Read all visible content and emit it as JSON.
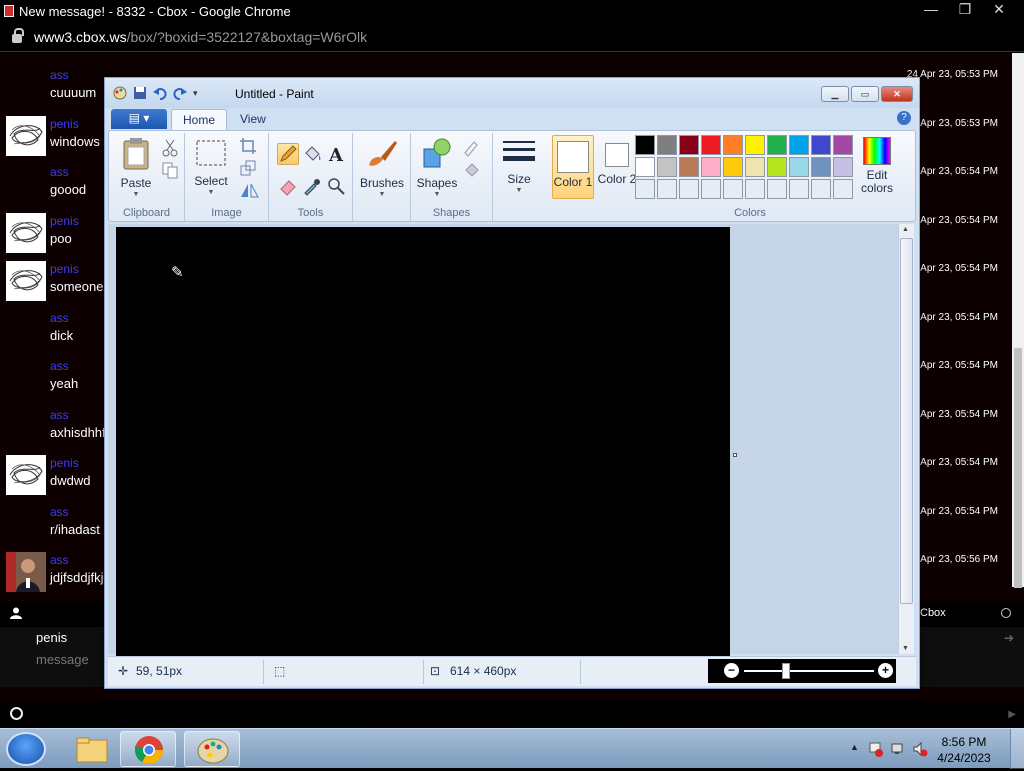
{
  "browser": {
    "tab_title": "New message! - 8332 - Cbox - Google Chrome",
    "url_host": "www3.cbox.ws",
    "url_path": "/box/?boxid=3522127&boxtag=W6rOlk"
  },
  "chat": {
    "messages": [
      {
        "name": "ass",
        "text": "cuuuum",
        "time": "24 Apr 23, 05:53 PM",
        "avatar": "none"
      },
      {
        "name": "penis",
        "text": "windows",
        "time": "4 Apr 23, 05:53 PM",
        "avatar": "scribble"
      },
      {
        "name": "ass",
        "text": "goood",
        "time": "4 Apr 23, 05:54 PM",
        "avatar": "none"
      },
      {
        "name": "penis",
        "text": "poo",
        "time": "4 Apr 23, 05:54 PM",
        "avatar": "scribble"
      },
      {
        "name": "penis",
        "text": "someone",
        "time": "4 Apr 23, 05:54 PM",
        "avatar": "scribble"
      },
      {
        "name": "ass",
        "text": "dick",
        "time": "4 Apr 23, 05:54 PM",
        "avatar": "none"
      },
      {
        "name": "ass",
        "text": "yeah",
        "time": "4 Apr 23, 05:54 PM",
        "avatar": "none"
      },
      {
        "name": "ass",
        "text": "axhisdhhf",
        "time": "4 Apr 23, 05:54 PM",
        "avatar": "none"
      },
      {
        "name": "penis",
        "text": "dwdwd",
        "time": "4 Apr 23, 05:54 PM",
        "avatar": "scribble"
      },
      {
        "name": "ass",
        "text": "r/ihadast",
        "time": "4 Apr 23, 05:54 PM",
        "avatar": "none"
      },
      {
        "name": "ass",
        "text": "jdjfsddjfkj",
        "time": "4 Apr 23, 05:56 PM",
        "avatar": "photo"
      }
    ],
    "footer_brand": "Cbox",
    "name_value": "penis",
    "message_placeholder": "message"
  },
  "paint": {
    "window_title": "Untitled - Paint",
    "tabs": [
      "Home",
      "View"
    ],
    "groups": {
      "clipboard": "Clipboard",
      "image": "Image",
      "tools": "Tools",
      "shapes": "Shapes",
      "colors": "Colors"
    },
    "buttons": {
      "paste": "Paste",
      "select": "Select",
      "brushes": "Brushes",
      "shapes": "Shapes",
      "size": "Size",
      "color1": "Color 1",
      "color2": "Color 2",
      "edit_colors": "Edit colors"
    },
    "palette": [
      "#000000",
      "#7f7f7f",
      "#880015",
      "#ed1c24",
      "#ff7f27",
      "#fff200",
      "#22b14c",
      "#00a2e8",
      "#3f48cc",
      "#a349a4",
      "#ffffff",
      "#c3c3c3",
      "#b97a57",
      "#ffaec9",
      "#ffc90e",
      "#efe4b0",
      "#b5e61d",
      "#99d9ea",
      "#7092be",
      "#c8bfe7",
      "#e6ecf4",
      "#e6ecf4",
      "#e6ecf4",
      "#e6ecf4",
      "#e6ecf4",
      "#e6ecf4",
      "#e6ecf4",
      "#e6ecf4",
      "#e6ecf4",
      "#e6ecf4"
    ],
    "status": {
      "cursor_pos": "59, 51px",
      "image_size": "614 × 460px"
    }
  },
  "taskbar": {
    "time": "8:56 PM",
    "date": "4/24/2023"
  }
}
